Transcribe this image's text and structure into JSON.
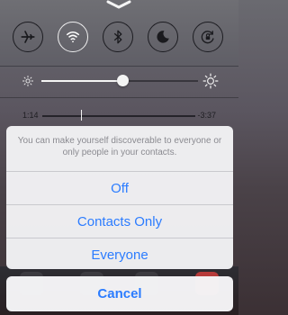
{
  "control_center": {
    "toggles": [
      {
        "name": "airplane-mode-toggle",
        "icon": "airplane-icon",
        "state": "off"
      },
      {
        "name": "wifi-toggle",
        "icon": "wifi-icon",
        "state": "on"
      },
      {
        "name": "bluetooth-toggle",
        "icon": "bluetooth-icon",
        "state": "off"
      },
      {
        "name": "do-not-disturb-toggle",
        "icon": "moon-icon",
        "state": "off"
      },
      {
        "name": "rotation-lock-toggle",
        "icon": "rotation-lock-icon",
        "state": "off"
      }
    ],
    "brightness": {
      "level": 0.52
    },
    "media": {
      "elapsed": "1:14",
      "remaining": "-3:37",
      "progress": 0.25
    }
  },
  "airdrop_sheet": {
    "message": "You can make yourself discoverable to everyone or only people in your contacts.",
    "options": [
      "Off",
      "Contacts Only",
      "Everyone"
    ],
    "cancel_label": "Cancel",
    "accent_color": "#2b7cff"
  }
}
